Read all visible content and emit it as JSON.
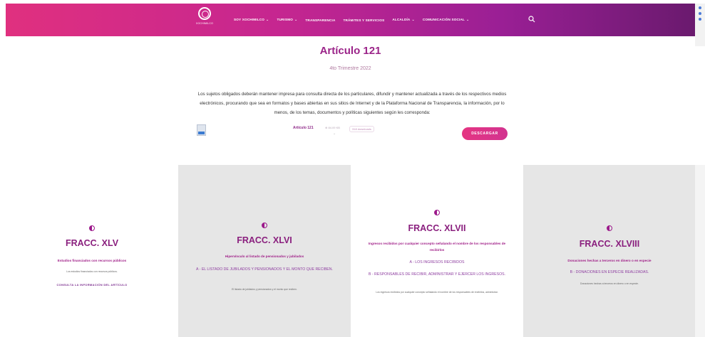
{
  "header": {
    "logo_text": "XOCHIMILCO",
    "nav": [
      {
        "label": "SOY XOCHIMILCO",
        "chevron": "⌄"
      },
      {
        "label": "TURISMO",
        "chevron": "⌄"
      },
      {
        "label": "TRANSPARENCIA",
        "chevron": ""
      },
      {
        "label": "TRÁMITES Y SERVICIOS",
        "chevron": ""
      },
      {
        "label": "ALCALDÍA",
        "chevron": "⌄"
      },
      {
        "label": "COMUNICACIÓN SOCIAL",
        "chevron": "⌄"
      }
    ],
    "search_icon": "search-icon"
  },
  "article": {
    "title": "Artículo 121",
    "subtitle": "4to Trimestre 2022",
    "body": "Los sujetos obligados deberán mantener impresa para consulta directa de los particulares, difundir y mantener actualizada a través de los respectivos medios electrónicos, procurando que sea en formatos y bases abiertas en sus sitios de Internet y de la Plataforma Nacional de Transparencia, la información, por lo menos, de los temas, documentos y políticas siguientes según les corresponda:",
    "file": {
      "name": "Artículo 121",
      "size": "⊕ 84.09 KB",
      "downloads": "318 downloads"
    },
    "download_label": "DESCARGAR"
  },
  "fractions": [
    {
      "title": "FRACC. XLV",
      "description": "Estudios financiados con recursos públicos",
      "links": [],
      "small": "Los estudios financiados con recursos públicos.",
      "cta": "CONSULTA LA INFORMACIÓN DEL ARTÍCULO"
    },
    {
      "title": "FRACC. XLVI",
      "description": "Hipervínculo al listado de pensionados y jubilados",
      "links": [
        "A - EL LISTADO DE JUBILADOS Y PENSIONADOS Y EL MONTO QUE RECIBEN."
      ],
      "small": "El listado de jubilados y pensionados y el monto que reciben.",
      "cta": ""
    },
    {
      "title": "FRACC. XLVII",
      "description": "Ingresos recibidos por cualquier concepto señalando el nombre de los responsables de recibirlos",
      "links": [
        "A - LOS INGRESOS RECIBIDOS",
        "B - RESPONSABLES DE RECIBIR, ADMINISTRAR Y EJERCER LOS INGRESOS."
      ],
      "small": "Los ingresos recibidos por cualquier concepto señalando el nombre de los responsables de recibirlos, administrar.",
      "cta": ""
    },
    {
      "title": "FRACC. XLVIII",
      "description": "Donaciones hechas a terceros en dinero o en especie",
      "links": [
        "B - DONACIONES EN ESPECIE REALIZADAS."
      ],
      "small": "Donaciones hechas a terceros en dinero o en especie.",
      "cta": ""
    }
  ]
}
